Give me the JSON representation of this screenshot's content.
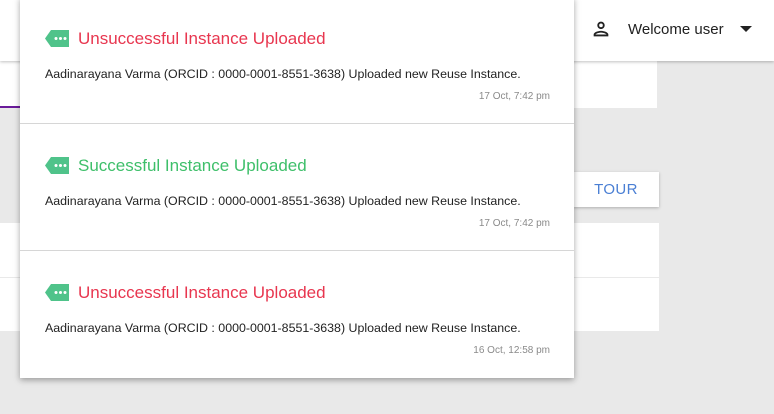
{
  "header": {
    "welcome_text": "Welcome user",
    "user_icon": "person-icon",
    "menu_icon": "caret-down-icon"
  },
  "background": {
    "tour_label": "TOUR"
  },
  "notifications": [
    {
      "title": "Unsuccessful Instance Uploaded",
      "status": "fail",
      "message": "Aadinarayana Varma (ORCID : 0000-0001-8551-3638) Uploaded new Reuse Instance.",
      "time": "17 Oct, 7:42 pm",
      "icon": "tag-icon"
    },
    {
      "title": "Successful Instance Uploaded",
      "status": "ok",
      "message": "Aadinarayana Varma (ORCID : 0000-0001-8551-3638) Uploaded new Reuse Instance.",
      "time": "17 Oct, 7:42 pm",
      "icon": "tag-icon"
    },
    {
      "title": "Unsuccessful Instance Uploaded",
      "status": "fail",
      "message": "Aadinarayana Varma (ORCID : 0000-0001-8551-3638) Uploaded new Reuse Instance.",
      "time": "16 Oct, 12:58 pm",
      "icon": "tag-icon"
    }
  ],
  "colors": {
    "fail": "#e8364f",
    "ok": "#3ebf6a",
    "tag": "#4fc38a",
    "accent": "#6a1b9a",
    "tour": "#4a7fd4"
  }
}
